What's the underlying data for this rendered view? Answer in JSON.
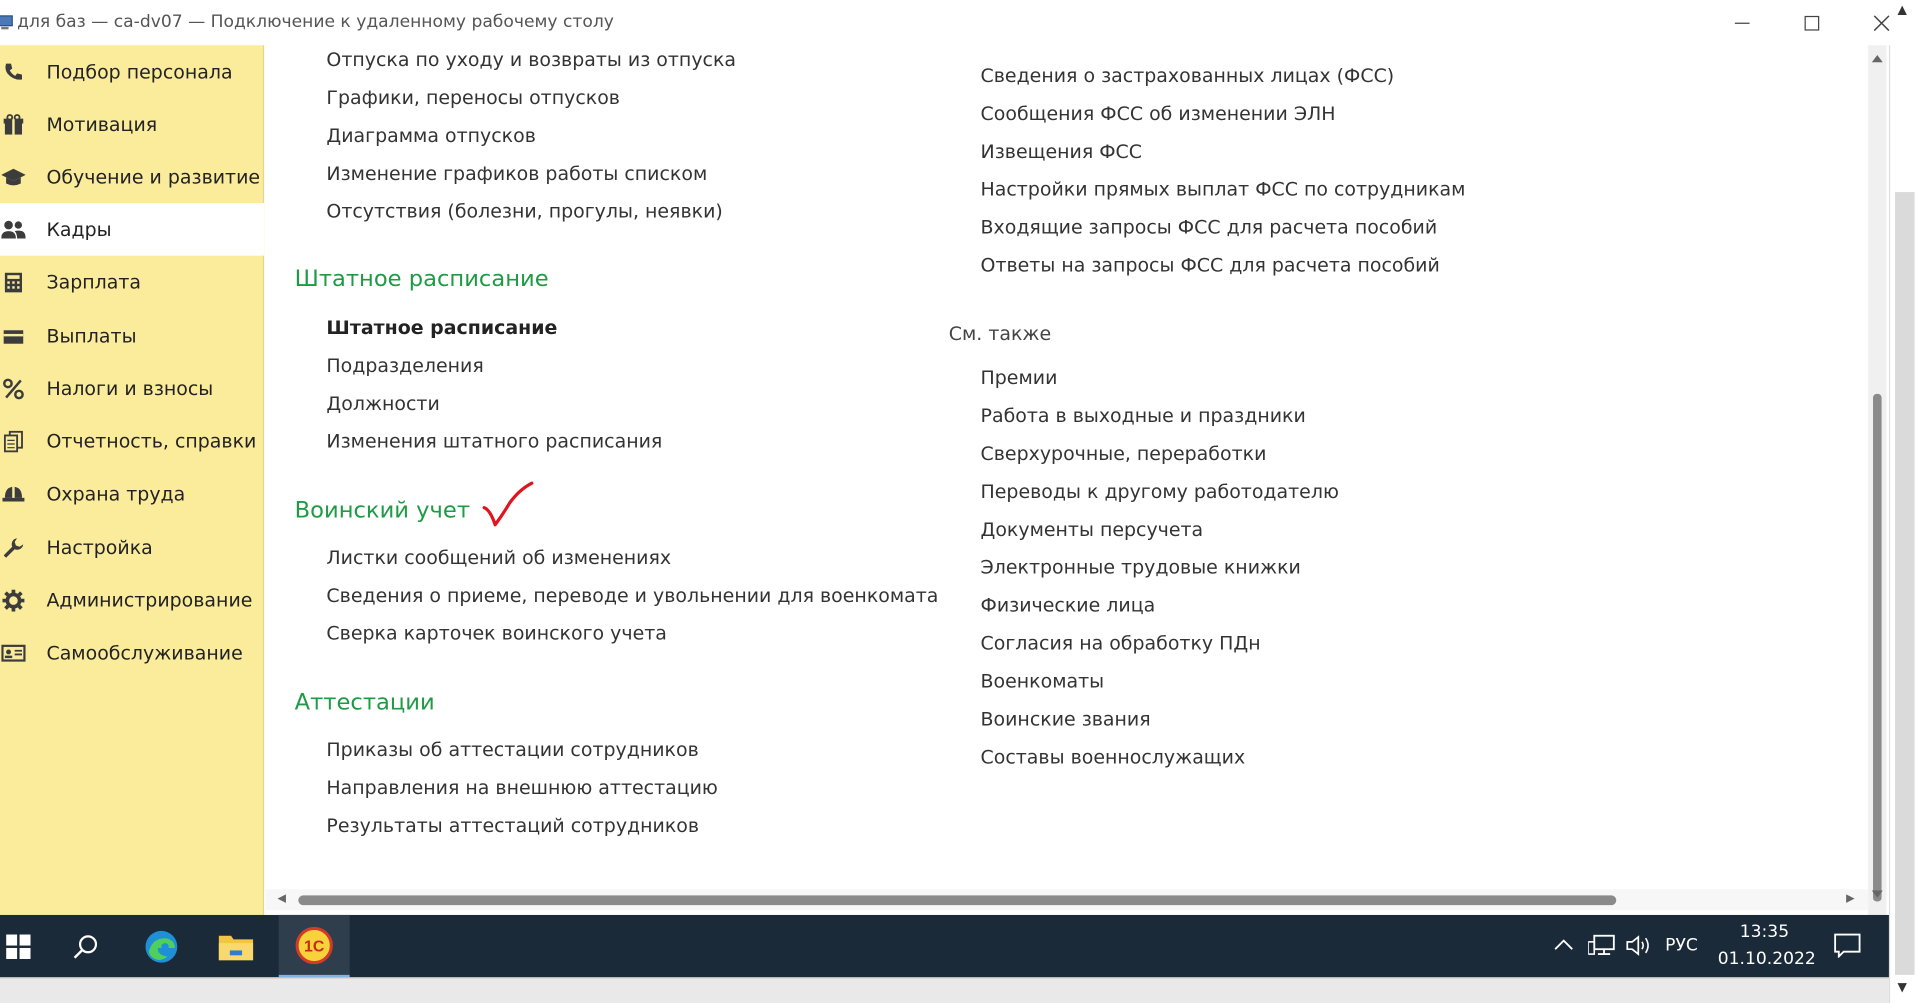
{
  "window": {
    "title": "для баз — ca-dv07 — Подключение к удаленному рабочему столу"
  },
  "sidebar": {
    "items": [
      {
        "label": "Подбор персонала",
        "icon": "phone-icon"
      },
      {
        "label": "Мотивация",
        "icon": "gift-icon"
      },
      {
        "label": "Обучение и развитие",
        "icon": "graduation-cap-icon"
      },
      {
        "label": "Кадры",
        "icon": "users-icon",
        "active": true
      },
      {
        "label": "Зарплата",
        "icon": "calculator-icon"
      },
      {
        "label": "Выплаты",
        "icon": "wallet-icon"
      },
      {
        "label": "Налоги и взносы",
        "icon": "percent-icon"
      },
      {
        "label": "Отчетность, справки",
        "icon": "documents-icon"
      },
      {
        "label": "Охрана труда",
        "icon": "helmet-icon"
      },
      {
        "label": "Настройка",
        "icon": "wrench-icon"
      },
      {
        "label": "Администрирование",
        "icon": "gear-icon"
      },
      {
        "label": "Самообслуживание",
        "icon": "id-card-icon"
      }
    ]
  },
  "content": {
    "left_top_links": [
      "Отпуска по уходу и возвраты из отпуска",
      "Графики, переносы отпусков",
      "Диаграмма отпусков",
      "Изменение графиков работы списком",
      "Отсутствия (болезни, прогулы, неявки)"
    ],
    "sections": [
      {
        "title": "Штатное расписание",
        "links": [
          "Штатное расписание",
          "Подразделения",
          "Должности",
          "Изменения штатного расписания"
        ]
      },
      {
        "title": "Воинский учет",
        "links": [
          "Листки сообщений об изменениях",
          "Сведения о приеме, переводе и увольнении для военкомата",
          "Сверка карточек воинского учета"
        ]
      },
      {
        "title": "Аттестации",
        "links": [
          "Приказы об аттестации сотрудников",
          "Направления на внешнюю аттестацию",
          "Результаты аттестаций сотрудников"
        ]
      }
    ],
    "right_top_links": [
      "Сведения о застрахованных лицах (ФСС)",
      "Сообщения ФСС об изменении ЭЛН",
      "Извещения ФСС",
      "Настройки прямых выплат ФСС по сотрудникам",
      "Входящие запросы ФСС для расчета пособий",
      "Ответы на запросы ФСС для расчета пособий"
    ],
    "see_also_label": "См. также",
    "see_also_links": [
      "Премии",
      "Работа в выходные и праздники",
      "Сверхурочные, переработки",
      "Переводы к другому работодателю",
      "Документы персучета",
      "Электронные трудовые книжки",
      "Физические лица",
      "Согласия на обработку ПДн",
      "Военкоматы",
      "Воинские звания",
      "Составы военнослужащих"
    ]
  },
  "taskbar": {
    "apps": [
      "windows-start-icon",
      "search-icon",
      "edge-icon",
      "file-explorer-icon",
      "1c-icon"
    ],
    "app_1c_label": "1С",
    "language": "РУС",
    "time": "13:35",
    "date": "01.10.2022"
  },
  "colors": {
    "sidebar_bg": "#fbec9c",
    "section_title": "#1f9b45",
    "taskbar_bg": "#1b2a38",
    "checkmark": "#e0141e"
  }
}
